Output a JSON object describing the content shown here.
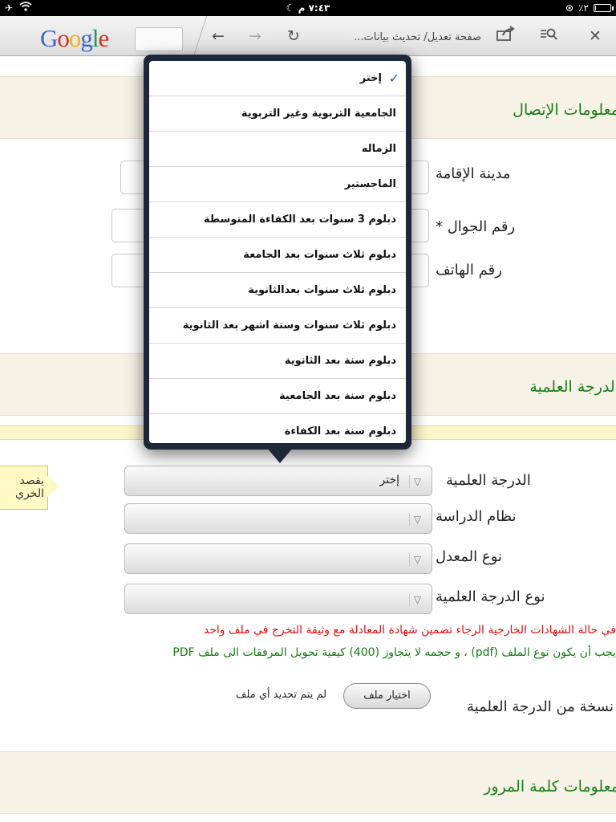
{
  "status_bar": {
    "time": "٧:٤٣ م",
    "battery": "٪٢",
    "battery_fraction": 0.02
  },
  "browser": {
    "logo_letters": [
      "G",
      "o",
      "o",
      "g",
      "l",
      "e"
    ],
    "page_title": "صفحة تعديل/ تحديث بيانات..."
  },
  "sections": {
    "contact_title": "معلومات الإتصال",
    "degree_title": "الدرجة العلمية",
    "password_title": "معلومات كلمة المرور"
  },
  "contact": {
    "city_label": "مدينة الإقامة",
    "mobile_label": "رقم الجوال *",
    "phone_label": "رقم الهاتف"
  },
  "degree_form": {
    "degree_label": "الدرجة العلمية",
    "degree_value": "إختر",
    "study_system_label": "نظام الدراسة",
    "grade_type_label": "نوع المعدل",
    "degree_type_label": "نوع الدرجة العلمية",
    "tooltip_line1": "يقصد",
    "tooltip_line2": "الخري",
    "red_note": "في حالة الشهادات الخارجية الرجاء تضمين شهادة المعادلة مع وثيقة التخرج في ملف واحد",
    "green_note": "يجب أن يكون نوع الملف (pdf) ، و حجمه لا يتجاوز (400) كيفية تحويل المرفقات الى ملف PDF",
    "copy_label": "نسخة من الدرجة العلمية",
    "choose_file_button": "اختيار ملف",
    "no_file_text": "لم يتم تحديد أي ملف"
  },
  "dropdown": {
    "selected_index": 0,
    "options": [
      "إختر",
      "الجامعية التربوية وغير التربوية",
      "الزماله",
      "الماجستير",
      "دبلوم 3 سنوات بعد الكفاءة المتوسطة",
      "دبلوم ثلاث سنوات بعد الجامعة",
      "دبلوم ثلاث سنوات بعدالثانوية",
      "دبلوم ثلاث سنوات وستة اشهر بعد الثانوية",
      "دبلوم سنة بعد الثانوية",
      "دبلوم سنة بعد الجامعية",
      "دبلوم سنة بعد الكفاءة"
    ]
  },
  "colors": {
    "section_title": "#1b7c1b",
    "note_red": "#dd1111",
    "note_green": "#117a11",
    "popover_frame": "#1e2737"
  }
}
